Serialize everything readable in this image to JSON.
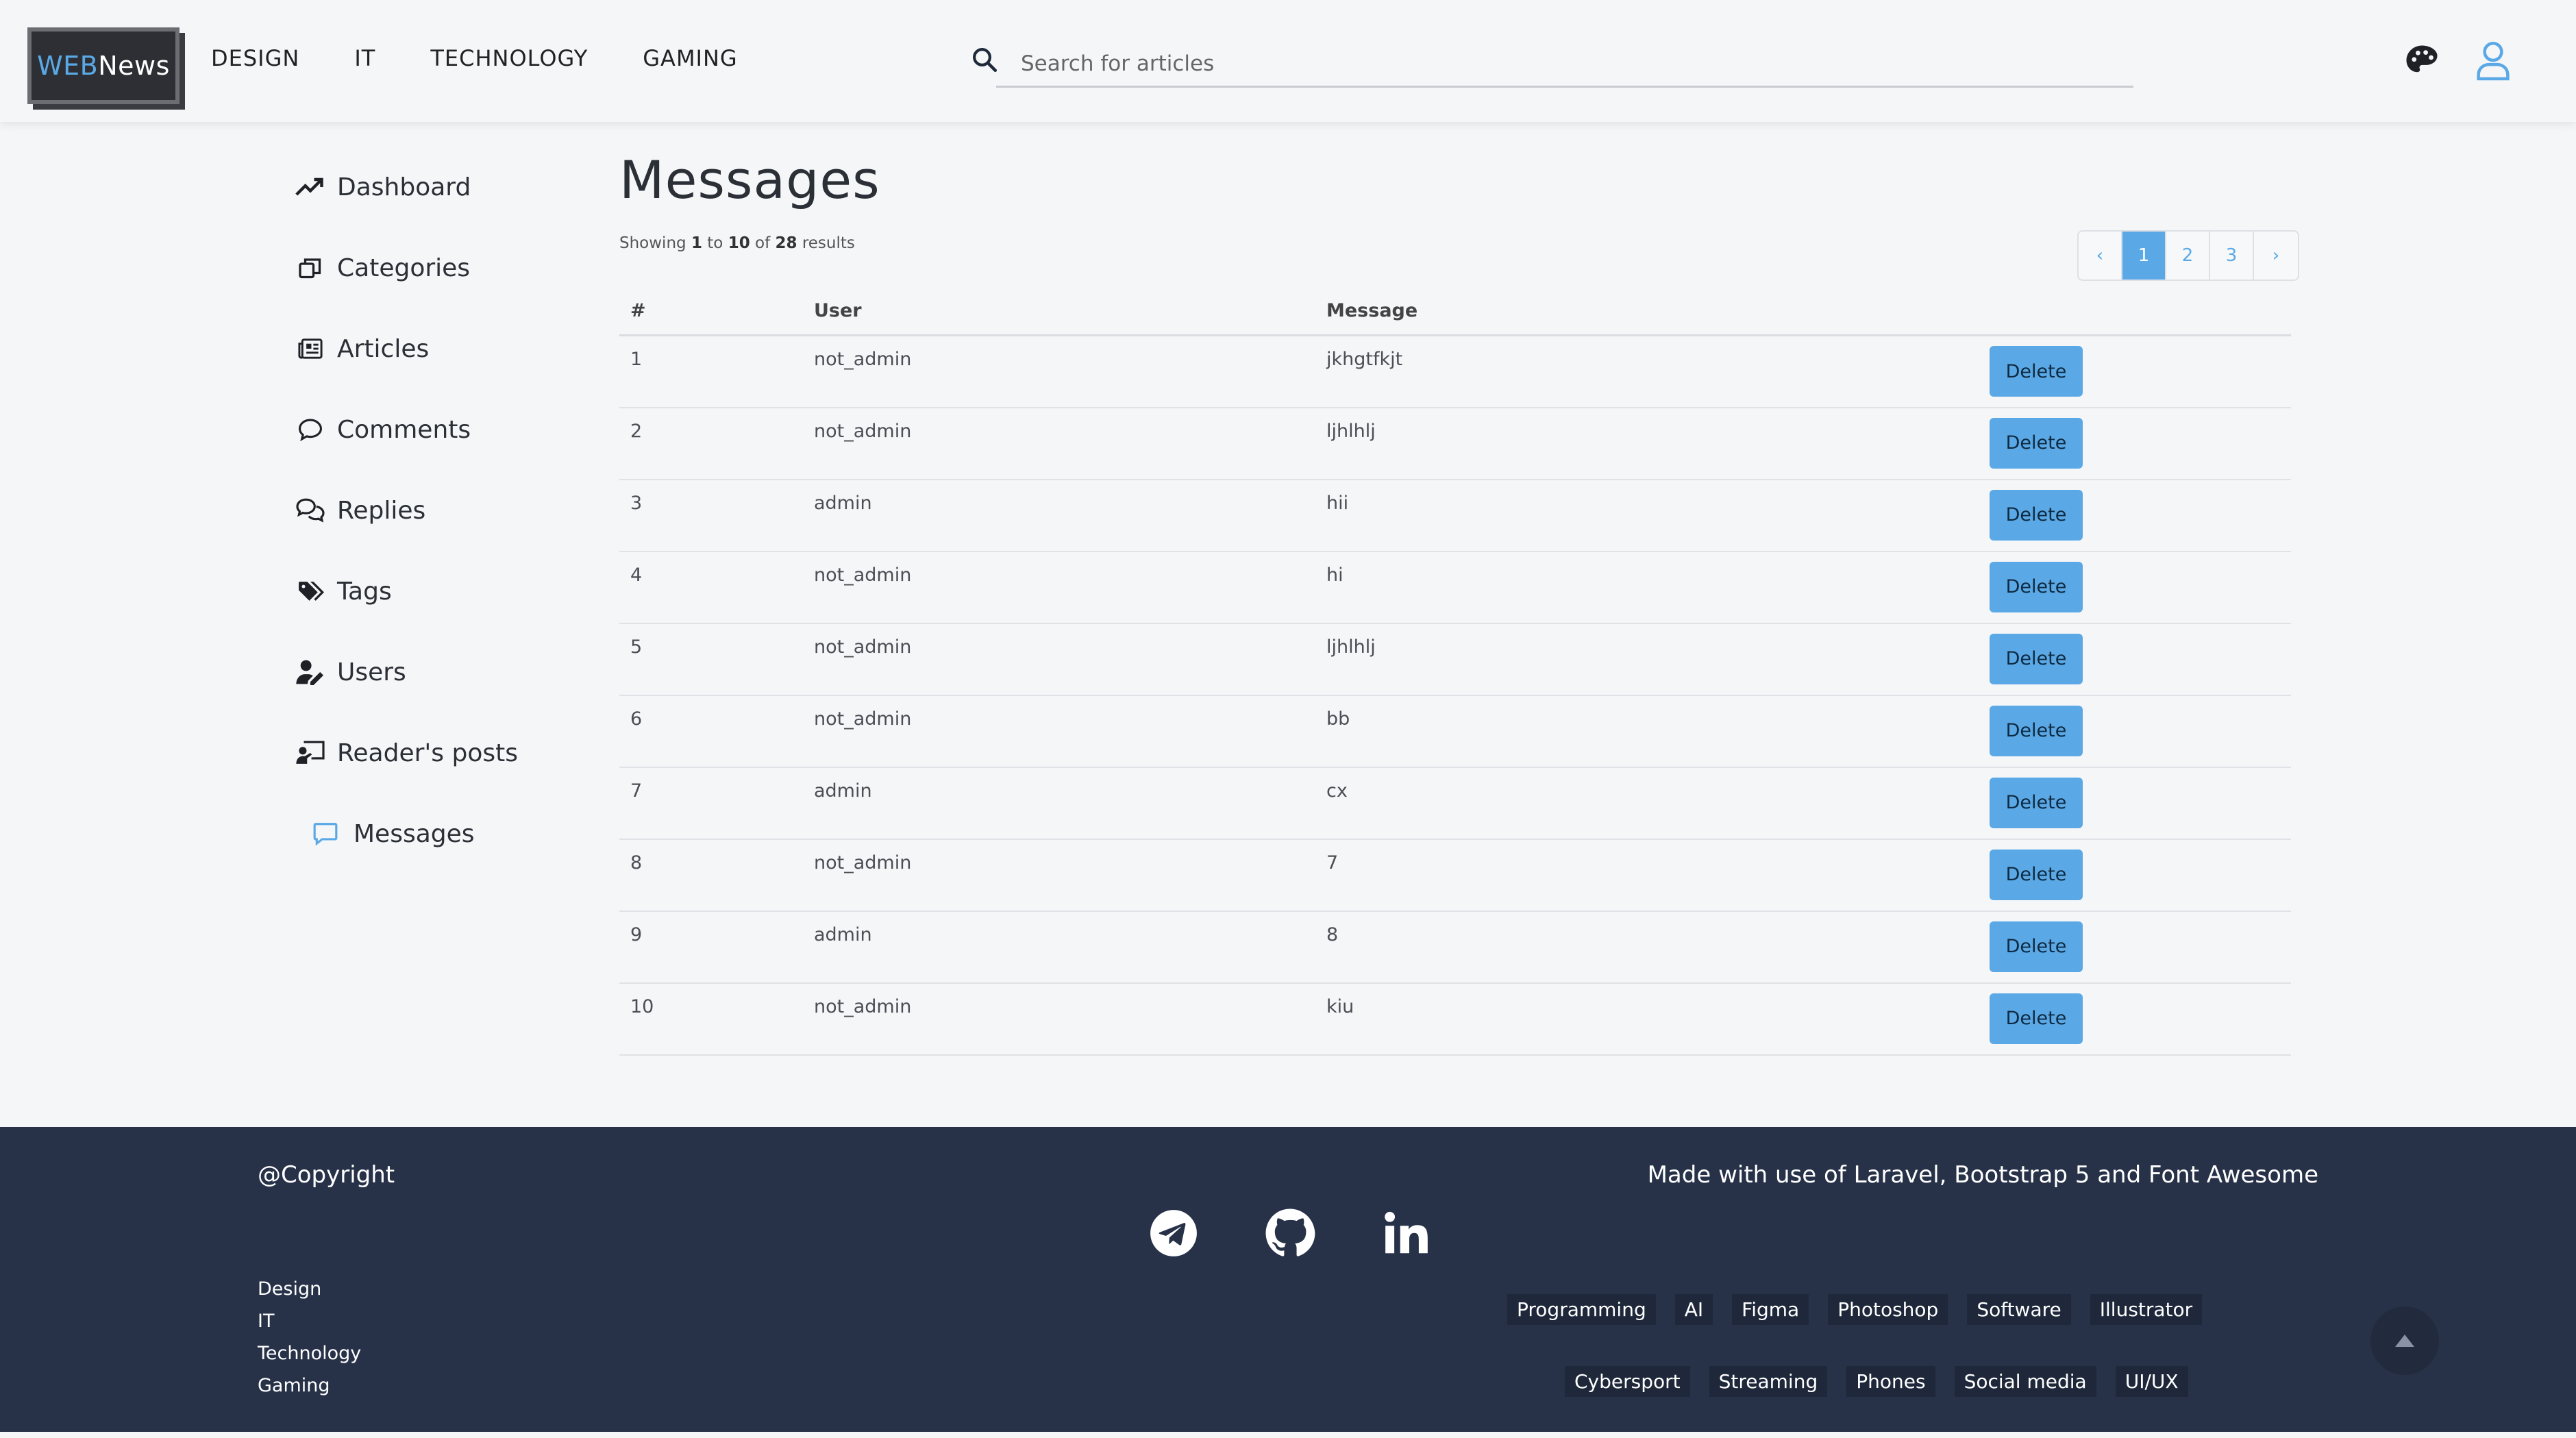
{
  "header": {
    "logo_web": "WEB",
    "logo_news": "News",
    "nav": [
      "DESIGN",
      "IT",
      "TECHNOLOGY",
      "GAMING"
    ],
    "search_placeholder": "Search for articles",
    "icons": [
      "search-icon",
      "palette-icon",
      "user-icon"
    ],
    "accent_color": "#5aa9e6"
  },
  "sidebar": {
    "items": [
      {
        "label": "Dashboard",
        "icon": "chart-line-icon"
      },
      {
        "label": "Categories",
        "icon": "window-restore-icon"
      },
      {
        "label": "Articles",
        "icon": "newspaper-icon"
      },
      {
        "label": "Comments",
        "icon": "comment-icon"
      },
      {
        "label": "Replies",
        "icon": "comments-icon"
      },
      {
        "label": "Tags",
        "icon": "tags-icon"
      },
      {
        "label": "Users",
        "icon": "user-pen-icon"
      },
      {
        "label": "Reader's posts",
        "icon": "chalkboard-user-icon"
      },
      {
        "label": "Messages",
        "icon": "message-icon"
      }
    ],
    "active": "Messages"
  },
  "main": {
    "title": "Messages",
    "results": {
      "prefix": "Showing",
      "from": "1",
      "to_word": "to",
      "to": "10",
      "of_word": "of",
      "total": "28",
      "suffix": "results"
    },
    "pagination": {
      "prev": "‹",
      "pages": [
        "1",
        "2",
        "3"
      ],
      "next": "›",
      "current": "1"
    },
    "columns": [
      "#",
      "User",
      "Message"
    ],
    "delete_label": "Delete",
    "rows": [
      {
        "id": "1",
        "user": "not_admin",
        "message": "jkhgtfkjt"
      },
      {
        "id": "2",
        "user": "not_admin",
        "message": "ljhlhlj"
      },
      {
        "id": "3",
        "user": "admin",
        "message": "hii"
      },
      {
        "id": "4",
        "user": "not_admin",
        "message": "hi"
      },
      {
        "id": "5",
        "user": "not_admin",
        "message": "ljhlhlj"
      },
      {
        "id": "6",
        "user": "not_admin",
        "message": "bb"
      },
      {
        "id": "7",
        "user": "admin",
        "message": "cx"
      },
      {
        "id": "8",
        "user": "not_admin",
        "message": "7"
      },
      {
        "id": "9",
        "user": "admin",
        "message": "8"
      },
      {
        "id": "10",
        "user": "not_admin",
        "message": "kiu"
      }
    ]
  },
  "footer": {
    "copyright": "@Copyright",
    "madewith": "Made with use of Laravel, Bootstrap 5 and Font Awesome",
    "socials": [
      "telegram-icon",
      "github-icon",
      "linkedin-icon"
    ],
    "links": [
      "Design",
      "IT",
      "Technology",
      "Gaming"
    ],
    "tags_row1": [
      "Programming",
      "AI",
      "Figma",
      "Photoshop",
      "Software",
      "Illustrator"
    ],
    "tags_row2": [
      "Cybersport",
      "Streaming",
      "Phones",
      "Social media",
      "UI/UX"
    ],
    "bg_color": "#273249"
  }
}
